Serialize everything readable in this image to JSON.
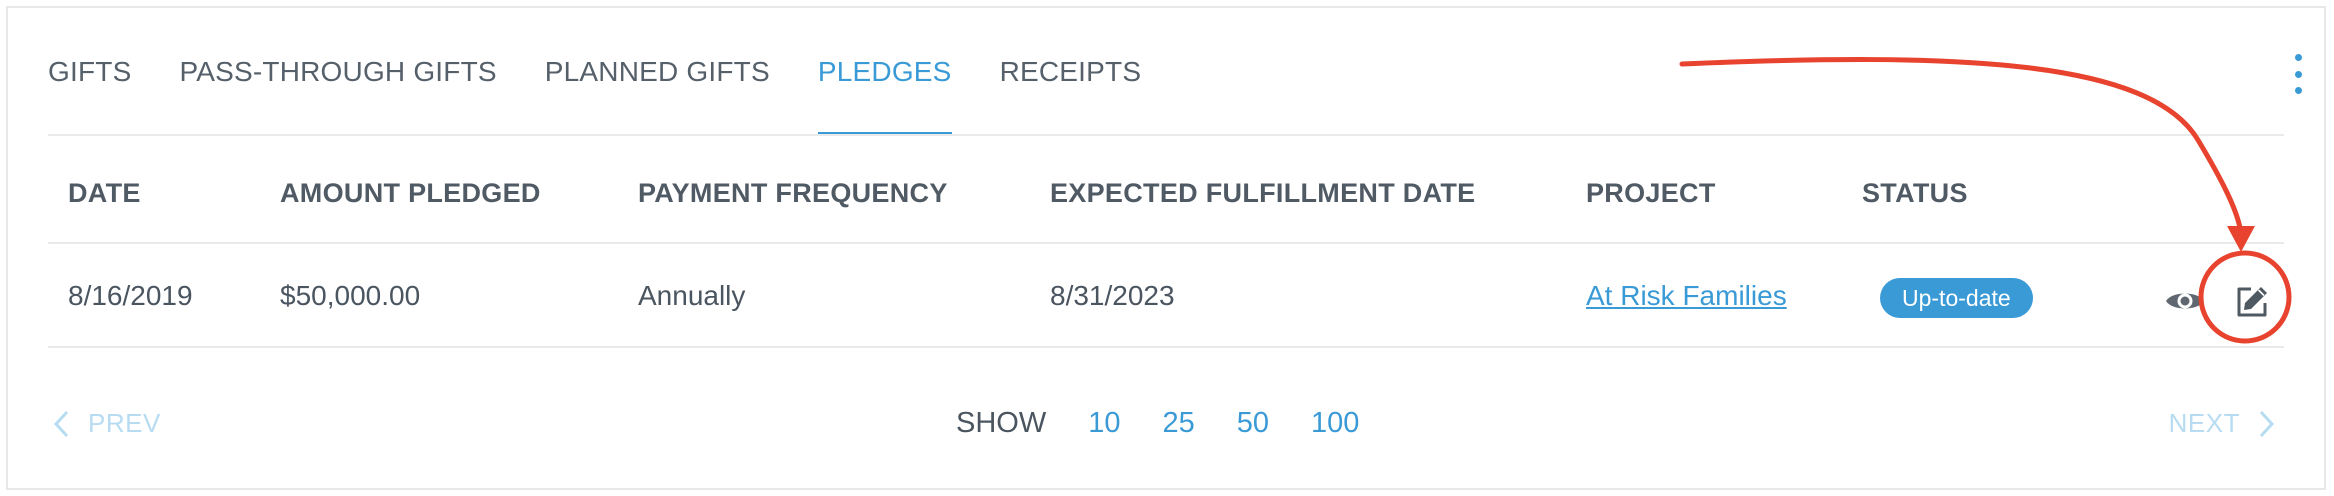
{
  "tabs": [
    {
      "label": "GIFTS",
      "active": false
    },
    {
      "label": "PASS-THROUGH GIFTS",
      "active": false
    },
    {
      "label": "PLANNED GIFTS",
      "active": false
    },
    {
      "label": "PLEDGES",
      "active": true
    },
    {
      "label": "RECEIPTS",
      "active": false
    }
  ],
  "table": {
    "headers": [
      "DATE",
      "AMOUNT PLEDGED",
      "PAYMENT FREQUENCY",
      "EXPECTED FULFILLMENT DATE",
      "PROJECT",
      "STATUS"
    ],
    "rows": [
      {
        "date": "8/16/2019",
        "amount": "$50,000.00",
        "frequency": "Annually",
        "fulfillment_date": "8/31/2023",
        "project": "At Risk Families",
        "status": "Up-to-date"
      }
    ]
  },
  "pagination": {
    "prev": "PREV",
    "next": "NEXT",
    "show_label": "SHOW",
    "page_sizes": [
      "10",
      "25",
      "50",
      "100"
    ]
  },
  "colors": {
    "accent": "#3a9ad6",
    "annotation": "#e8432e",
    "disabled": "#b7dcf2"
  },
  "icons": {
    "more": "kebab-vertical-icon",
    "view": "eye-icon",
    "edit": "edit-pencil-icon",
    "prev": "chevron-left-icon",
    "next": "chevron-right-icon"
  }
}
